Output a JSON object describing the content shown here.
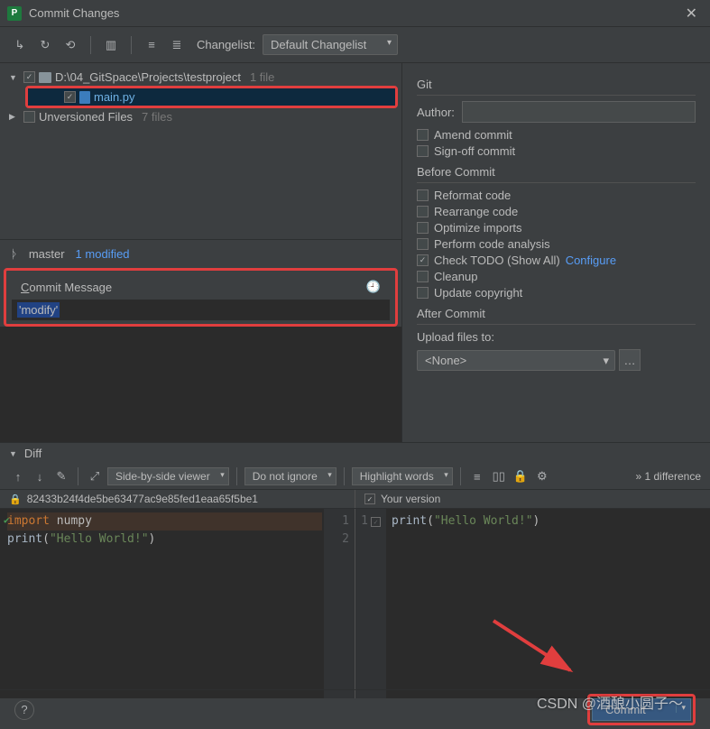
{
  "window": {
    "title": "Commit Changes"
  },
  "toolbar": {
    "changelist_label": "Changelist:",
    "changelist_value": "Default Changelist"
  },
  "tree": {
    "root_path": "D:\\04_GitSpace\\Projects\\testproject",
    "root_count": "1 file",
    "file_name": "main.py",
    "unversioned_label": "Unversioned Files",
    "unversioned_count": "7 files"
  },
  "vcs_status": {
    "branch": "master",
    "modified": "1 modified"
  },
  "commit_message": {
    "header": "Commit Message",
    "value": "'modify'"
  },
  "git_panel": {
    "title": "Git",
    "author_label": "Author:",
    "author_value": "",
    "amend": "Amend commit",
    "signoff": "Sign-off commit",
    "before_title": "Before Commit",
    "reformat": "Reformat code",
    "rearrange": "Rearrange code",
    "optimize": "Optimize imports",
    "analysis": "Perform code analysis",
    "todo": "Check TODO (Show All)",
    "configure": "Configure",
    "cleanup": "Cleanup",
    "copyright": "Update copyright",
    "after_title": "After Commit",
    "upload_label": "Upload files to:",
    "upload_value": "<None>"
  },
  "diff": {
    "title": "Diff",
    "viewer_mode": "Side-by-side viewer",
    "ignore_mode": "Do not ignore",
    "highlight_mode": "Highlight words",
    "diff_count": "1 difference",
    "left_rev": "82433b24f4de5be63477ac9e85fed1eaa65f5be1",
    "right_rev": "Your version",
    "left_code": [
      {
        "n": 1,
        "kw": "import",
        "rest": " numpy",
        "deleted": true
      },
      {
        "n": 2,
        "fn": "print",
        "paren_open": "(",
        "str": "\"Hello World!\"",
        "paren_close": ")",
        "deleted": false
      }
    ],
    "right_code": [
      {
        "n": 1,
        "fn": "print",
        "paren_open": "(",
        "str": "\"Hello World!\"",
        "paren_close": ")"
      }
    ]
  },
  "footer": {
    "commit_label": "Commit"
  },
  "watermark": "CSDN @酒酿小圆子～",
  "chart_data": null
}
